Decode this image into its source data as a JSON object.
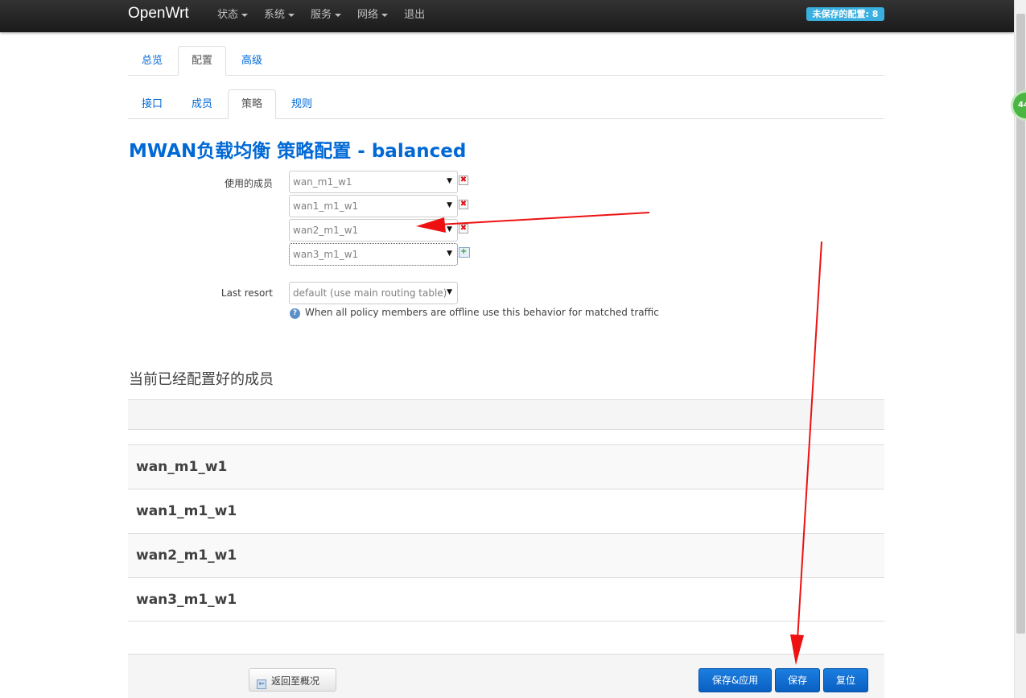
{
  "navbar": {
    "brand": "OpenWrt",
    "menu": [
      {
        "label": "状态",
        "has_caret": true
      },
      {
        "label": "系统",
        "has_caret": true
      },
      {
        "label": "服务",
        "has_caret": true
      },
      {
        "label": "网络",
        "has_caret": true
      },
      {
        "label": "退出",
        "has_caret": false
      }
    ],
    "unsaved_badge": "未保存的配置: 8"
  },
  "side_badge": "44",
  "tabs_top": [
    {
      "label": "总览",
      "active": false
    },
    {
      "label": "配置",
      "active": true
    },
    {
      "label": "高级",
      "active": false
    }
  ],
  "tabs_sub": [
    {
      "label": "接口",
      "active": false
    },
    {
      "label": "成员",
      "active": false
    },
    {
      "label": "策略",
      "active": true
    },
    {
      "label": "规则",
      "active": false
    }
  ],
  "page_title": "MWAN负载均衡 策略配置 - balanced",
  "form": {
    "members_label": "使用的成员",
    "members": [
      "wan_m1_w1",
      "wan1_m1_w1",
      "wan2_m1_w1",
      "wan3_m1_w1"
    ],
    "last_resort_label": "Last resort",
    "last_resort_value": "default (use main routing table)",
    "help_text": "When all policy members are offline use this behavior for matched traffic"
  },
  "members_section": {
    "title": "当前已经配置好的成员",
    "rows": [
      "wan_m1_w1",
      "wan1_m1_w1",
      "wan2_m1_w1",
      "wan3_m1_w1"
    ]
  },
  "actions": {
    "back_label": "返回至概况",
    "save_apply_label": "保存&应用",
    "save_label": "保存",
    "reset_label": "复位"
  },
  "colors": {
    "link": "#0069d6",
    "primary_button": "#0a5fc2",
    "navbar": "#222222",
    "unsaved_badge": "#3ab0e0",
    "annotation_arrow": "#ee1111"
  }
}
